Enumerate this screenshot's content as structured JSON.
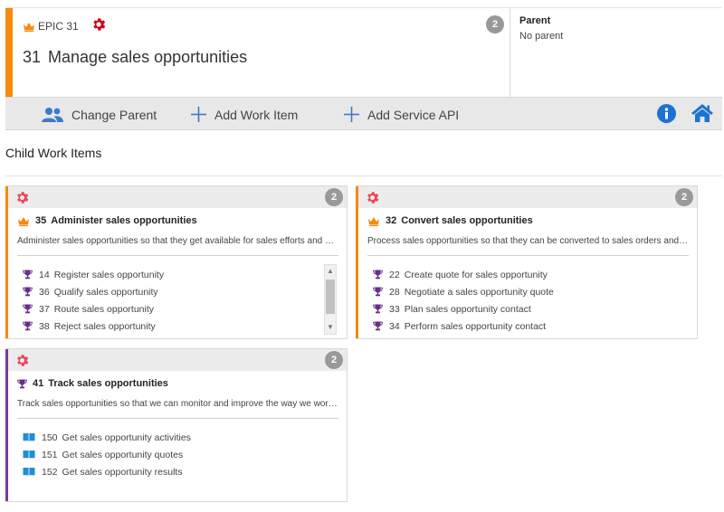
{
  "header": {
    "epic_label": "EPIC 31",
    "number": "31",
    "title": "Manage sales opportunities",
    "badge": "2",
    "parent_label": "Parent",
    "parent_value": "No parent",
    "accent_color": "#f7890c"
  },
  "toolbar": {
    "change_parent": "Change Parent",
    "add_work_item": "Add Work Item",
    "add_service_api": "Add Service API",
    "info_icon": "info-icon",
    "home_icon": "home-icon"
  },
  "section": {
    "title": "Child Work Items"
  },
  "cards": [
    {
      "number": "35",
      "title": "Administer sales opportunities",
      "badge": "2",
      "type_icon": "crown-icon",
      "accent_color": "#f7890c",
      "description": "Administer sales opportunities so that they get available for sales efforts and activities",
      "items": [
        {
          "number": "14",
          "label": "Register sales opportunity",
          "icon": "trophy-icon"
        },
        {
          "number": "36",
          "label": "Qualify sales opportunity",
          "icon": "trophy-icon"
        },
        {
          "number": "37",
          "label": "Route sales opportunity",
          "icon": "trophy-icon"
        },
        {
          "number": "38",
          "label": "Reject sales opportunity",
          "icon": "trophy-icon"
        }
      ]
    },
    {
      "number": "32",
      "title": "Convert sales opportunities",
      "badge": "2",
      "type_icon": "crown-icon",
      "accent_color": "#f7890c",
      "description": "Process sales opportunities so that they can be converted to sales orders and revenue",
      "items": [
        {
          "number": "22",
          "label": "Create quote for sales opportunity",
          "icon": "trophy-icon"
        },
        {
          "number": "28",
          "label": "Negotiate a sales opportunity quote",
          "icon": "trophy-icon"
        },
        {
          "number": "33",
          "label": "Plan sales opportunity contact",
          "icon": "trophy-icon"
        },
        {
          "number": "34",
          "label": "Perform sales opportunity contact",
          "icon": "trophy-icon"
        }
      ]
    },
    {
      "number": "41",
      "title": "Track sales opportunities",
      "badge": "2",
      "type_icon": "trophy-icon",
      "accent_color": "#7b3a96",
      "description": "Track sales opportunities so that we can monitor and improve the way we work with sales",
      "items": [
        {
          "number": "150",
          "label": "Get sales opportunity activities",
          "icon": "book-icon"
        },
        {
          "number": "151",
          "label": "Get sales opportunity quotes",
          "icon": "book-icon"
        },
        {
          "number": "152",
          "label": "Get sales opportunity results",
          "icon": "book-icon"
        }
      ]
    }
  ]
}
